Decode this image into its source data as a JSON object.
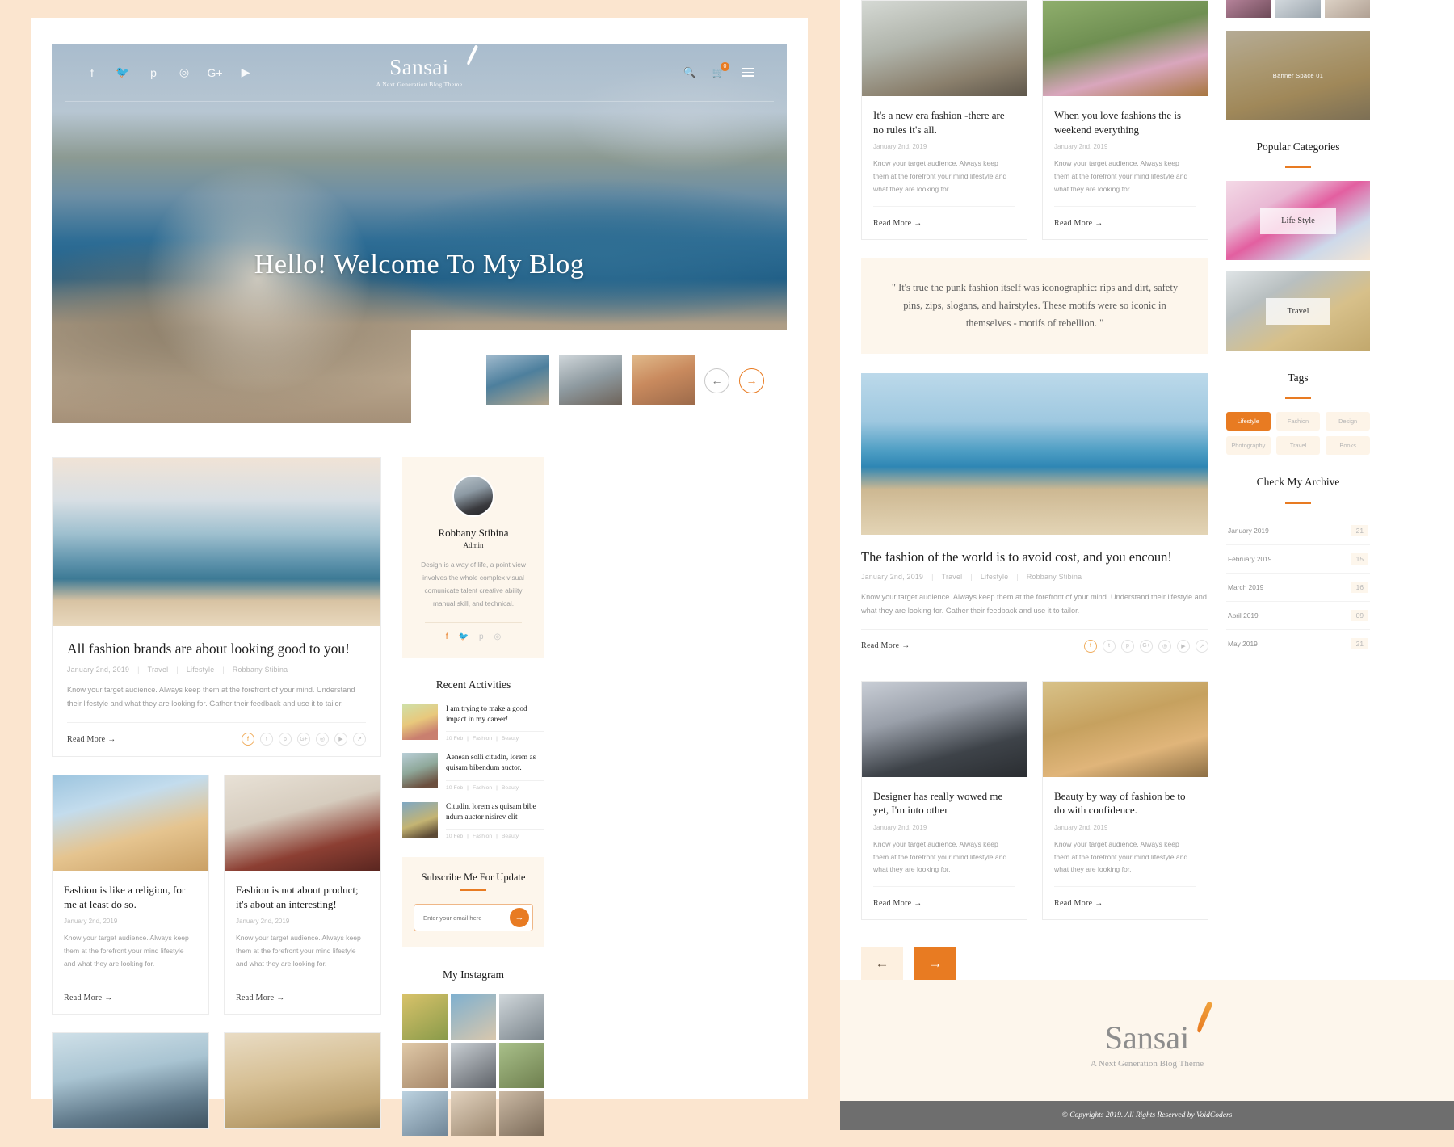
{
  "site": {
    "logo_name": "Sansai",
    "logo_tagline": "A Next Generation Blog Theme",
    "copyright": "© Copyrights 2019. All Rights Reserved by VoidCoders"
  },
  "header": {
    "social": [
      "facebook-icon",
      "twitter-icon",
      "pinterest-icon",
      "instagram-icon",
      "google-plus-icon",
      "youtube-icon"
    ],
    "cart_count": "0"
  },
  "hero": {
    "title": "Hello! Welcome To My Blog",
    "prev_label": "←",
    "next_label": "→"
  },
  "featured_post": {
    "title": "All fashion brands are about looking good to you!",
    "date": "January 2nd, 2019",
    "cat1": "Travel",
    "cat2": "Lifestyle",
    "author": "Robbany Stibina",
    "excerpt": "Know your target audience. Always keep them at the forefront of your mind. Understand their lifestyle and what they are looking for. Gather their feedback and use it to tailor.",
    "read_more": "Read More  →"
  },
  "half_posts": [
    {
      "title": "Fashion is like a religion, for me at least do so.",
      "date": "January 2nd, 2019",
      "excerpt": "Know your target audience. Always keep them at the forefront your mind lifestyle and what they are looking for.",
      "read_more": "Read More  →"
    },
    {
      "title": "Fashion is not about product; it's about an interesting!",
      "date": "January 2nd, 2019",
      "excerpt": "Know your target audience. Always keep them at the forefront your mind lifestyle and what they are looking for.",
      "read_more": "Read More  →"
    }
  ],
  "author_widget": {
    "name": "Robbany Stibina",
    "role": "Admin",
    "description": "Design is a way of life, a point view involves the whole complex visual comunicate talent creative ability manual skill, and technical.",
    "social": [
      "facebook-icon",
      "twitter-icon",
      "pinterest-icon",
      "instagram-icon"
    ]
  },
  "recent_activities": {
    "heading": "Recent Activities",
    "items": [
      {
        "title": "I am trying to make a good impact in my career!",
        "date": "10 Feb",
        "cat1": "Fashion",
        "cat2": "Beauty"
      },
      {
        "title": "Aenean solli citudin, lorem as quisam bibendum auctor.",
        "date": "10 Feb",
        "cat1": "Fashion",
        "cat2": "Beauty"
      },
      {
        "title": "Citudin, lorem as quisam bibe ndum auctor nisirev elit",
        "date": "10 Feb",
        "cat1": "Fashion",
        "cat2": "Beauty"
      }
    ]
  },
  "subscribe": {
    "heading": "Subscribe Me For Update",
    "placeholder": "Enter your email here",
    "button_icon": "arrow-right-icon"
  },
  "instagram": {
    "heading": "My Instagram"
  },
  "right_posts": [
    {
      "title": "It's a new era fashion -there are no rules it's all.",
      "date": "January 2nd, 2019",
      "excerpt": "Know your target audience. Always keep them at the forefront your mind lifestyle and what they are looking for.",
      "read_more": "Read More  →"
    },
    {
      "title": "When you love fashions the is weekend everything",
      "date": "January 2nd, 2019",
      "excerpt": "Know your target audience. Always keep them at the forefront your mind lifestyle and what they are looking for.",
      "read_more": "Read More  →"
    }
  ],
  "quote": {
    "text": "\" It's true the punk fashion itself was iconographic: rips and dirt, safety pins, zips, slogans, and hairstyles. These motifs were so iconic in themselves - motifs of rebellion. \""
  },
  "big_post": {
    "title": "The fashion of the world is to avoid cost, and you encoun!",
    "date": "January 2nd, 2019",
    "cat1": "Travel",
    "cat2": "Lifestyle",
    "author": "Robbany Stibina",
    "excerpt": "Know your target audience. Always keep them at the forefront of your mind. Understand their lifestyle and what they are looking for. Gather their feedback and use it to tailor.",
    "read_more": "Read More  →"
  },
  "bottom_posts": [
    {
      "title": "Designer has really wowed me yet, I'm into other",
      "date": "January 2nd, 2019",
      "excerpt": "Know your target audience. Always keep them at the forefront your mind lifestyle and what they are looking for.",
      "read_more": "Read More  →"
    },
    {
      "title": "Beauty by way of fashion be to do with confidence.",
      "date": "January 2nd, 2019",
      "excerpt": "Know your target audience. Always keep them at the forefront your mind lifestyle and what they are looking for.",
      "read_more": "Read More  →"
    }
  ],
  "pagination": {
    "prev": "←",
    "next": "→"
  },
  "banner": {
    "label": "Banner Space 01"
  },
  "popular_categories": {
    "heading": "Popular Categories",
    "items": [
      {
        "label": "Life Style"
      },
      {
        "label": "Travel"
      }
    ]
  },
  "tags": {
    "heading": "Tags",
    "items": [
      "Lifestyle",
      "Fashion",
      "Design",
      "Photography",
      "Travel",
      "Books"
    ],
    "active_index": 0
  },
  "archive": {
    "heading": "Check My Archive",
    "items": [
      {
        "name": "January 2019",
        "count": "21"
      },
      {
        "name": "February 2019",
        "count": "15"
      },
      {
        "name": "March 2019",
        "count": "16"
      },
      {
        "name": "April 2019",
        "count": "09"
      },
      {
        "name": "May 2019",
        "count": "21"
      }
    ]
  },
  "colors": {
    "accent": "#e87b22",
    "cream": "#fdf6ec",
    "page_bg": "#fbe5cf"
  }
}
